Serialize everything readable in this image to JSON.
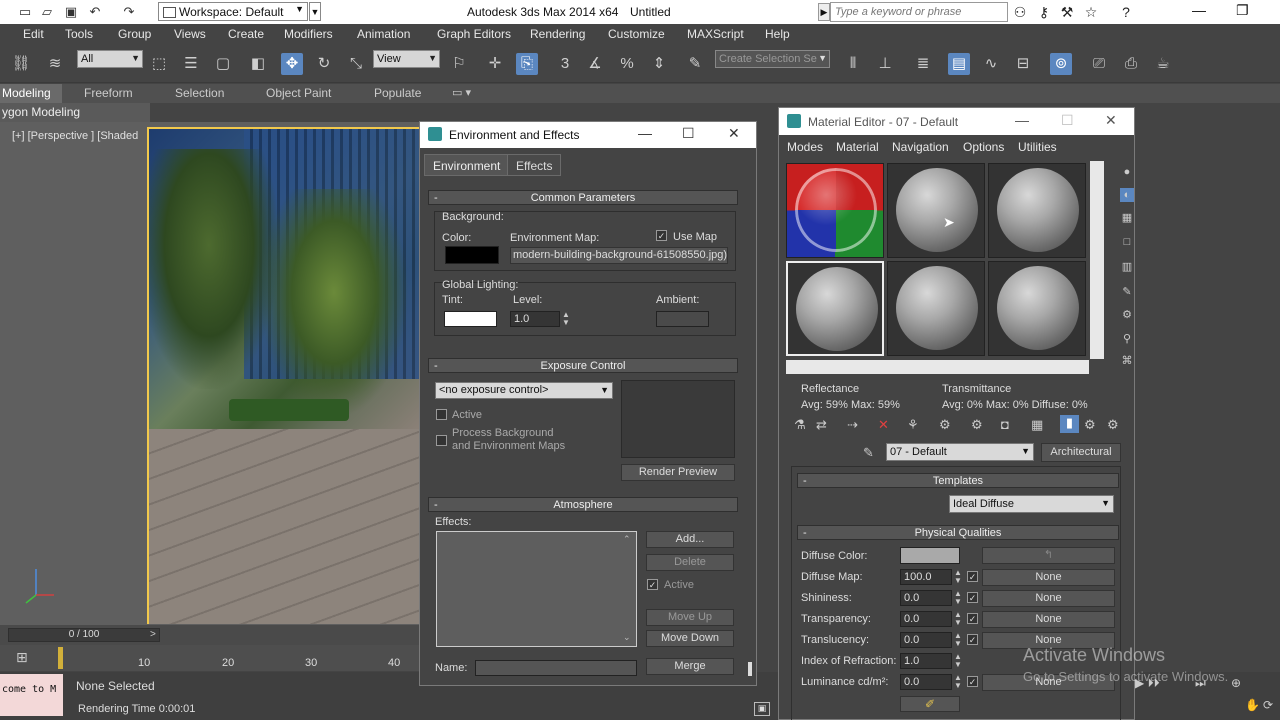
{
  "titlebar": {
    "workspace": "Workspace: Default",
    "app_title": "Autodesk 3ds Max  2014 x64",
    "doc_title": "Untitled",
    "search_placeholder": "Type a keyword or phrase",
    "icons": [
      "new-icon",
      "open-icon",
      "save-icon",
      "undo-icon",
      "redo-icon",
      "binoculars-icon",
      "key-icon",
      "star-icon",
      "help-icon"
    ],
    "win_min": "—",
    "win_max": "❐"
  },
  "menubar": [
    "Edit",
    "Tools",
    "Group",
    "Views",
    "Create",
    "Modifiers",
    "Animation",
    "Graph Editors",
    "Rendering",
    "Customize",
    "MAXScript",
    "Help"
  ],
  "toolbar": {
    "filter_value": "All",
    "refcoord_value": "View",
    "selection_set_placeholder": "Create Selection Se",
    "snap_labels": [
      "3",
      "%"
    ]
  },
  "ribbon": {
    "tabs": [
      "Modeling",
      "Freeform",
      "Selection",
      "Object Paint",
      "Populate"
    ],
    "active_tab": "Modeling",
    "sub_label": "ygon Modeling"
  },
  "viewport": {
    "label": "[+] [Perspective ] [Shaded"
  },
  "timeline": {
    "frame_display": "0 / 100",
    "ticks": [
      "10",
      "20",
      "30",
      "40"
    ]
  },
  "status": {
    "maxscript_text": "come to M",
    "selection": "None Selected",
    "render_time": "Rendering Time  0:00:01"
  },
  "env_dialog": {
    "title": "Environment and Effects",
    "tabs": [
      "Environment",
      "Effects"
    ],
    "common_params": "Common Parameters",
    "background_label": "Background:",
    "color_label": "Color:",
    "env_map_label": "Environment Map:",
    "use_map_label": "Use Map",
    "env_map_value": "modern-building-background-61508550.jpg)",
    "global_lighting": "Global Lighting:",
    "tint_label": "Tint:",
    "level_label": "Level:",
    "level_value": "1.0",
    "ambient_label": "Ambient:",
    "exposure_control": "Exposure Control",
    "exposure_value": "<no exposure control>",
    "active_label": "Active",
    "process_bg_label": "Process Background\nand Environment Maps",
    "render_preview": "Render Preview",
    "atmosphere": "Atmosphere",
    "effects_label": "Effects:",
    "add": "Add...",
    "delete": "Delete",
    "atm_active": "Active",
    "move_up": "Move Up",
    "move_down": "Move Down",
    "name_label": "Name:",
    "merge": "Merge",
    "colors": {
      "bg_color": "#000000",
      "tint": "#ffffff",
      "ambient": "#4a4a4a"
    }
  },
  "mat_editor": {
    "title": "Material Editor - 07 - Default",
    "menus": [
      "Modes",
      "Material",
      "Navigation",
      "Options",
      "Utilities"
    ],
    "reflectance_label": "Reflectance",
    "reflectance_value": "Avg:  59% Max:  59%",
    "transmittance_label": "Transmittance",
    "transmittance_value": "Avg:   0% Max:   0%  Diffuse:   0%",
    "material_name": "07 - Default",
    "material_type": "Architectural",
    "templates": "Templates",
    "template_value": "Ideal Diffuse",
    "physical_qualities": "Physical Qualities",
    "rows": [
      {
        "label": "Diffuse Color:",
        "value": "",
        "map": ""
      },
      {
        "label": "Diffuse Map:",
        "value": "100.0",
        "map": "None"
      },
      {
        "label": "Shininess:",
        "value": "0.0",
        "map": "None"
      },
      {
        "label": "Transparency:",
        "value": "0.0",
        "map": "None"
      },
      {
        "label": "Translucency:",
        "value": "0.0",
        "map": "None"
      },
      {
        "label": "Index of Refraction:",
        "value": "1.0",
        "map": ""
      },
      {
        "label": "Luminance cd/m²:",
        "value": "0.0",
        "map": "None"
      }
    ],
    "diffuse_color": "#a9a9a9"
  },
  "watermark": {
    "line1": "Activate Windows",
    "line2": "Go to Settings to activate Windows."
  }
}
